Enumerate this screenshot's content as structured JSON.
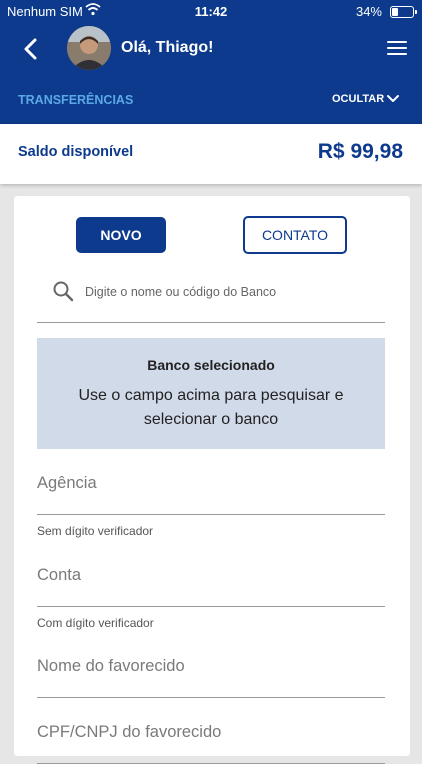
{
  "status_bar": {
    "carrier": "Nenhum SIM",
    "time": "11:42",
    "battery": "34%"
  },
  "header": {
    "greeting": "Olá, Thiago!",
    "section_title": "TRANSFERÊNCIAS",
    "hide_label": "OCULTAR"
  },
  "balance": {
    "label": "Saldo disponível",
    "value": "R$ 99,98"
  },
  "buttons": {
    "novo": "NOVO",
    "contato": "CONTATO"
  },
  "search": {
    "placeholder": "Digite o nome ou código do Banco",
    "value": ""
  },
  "bank_box": {
    "title": "Banco selecionado",
    "message": "Use o campo acima para pesquisar e selecionar o banco"
  },
  "fields": {
    "agencia": {
      "placeholder": "Agência",
      "hint": "Sem dígito verificador"
    },
    "conta": {
      "placeholder": "Conta",
      "hint": "Com dígito verificador"
    },
    "nome": {
      "placeholder": "Nome do favorecido"
    },
    "cpf": {
      "placeholder": "CPF/CNPJ do favorecido"
    }
  },
  "colors": {
    "brand": "#0d3a8c",
    "accent_text": "#5aa8e6",
    "bank_box_bg": "#d1dae8"
  },
  "icons": {
    "back": "chevron-left-icon",
    "menu": "hamburger-menu-icon",
    "search": "search-icon",
    "hide": "chevron-down-icon",
    "wifi": "wifi-icon",
    "battery": "battery-icon"
  }
}
